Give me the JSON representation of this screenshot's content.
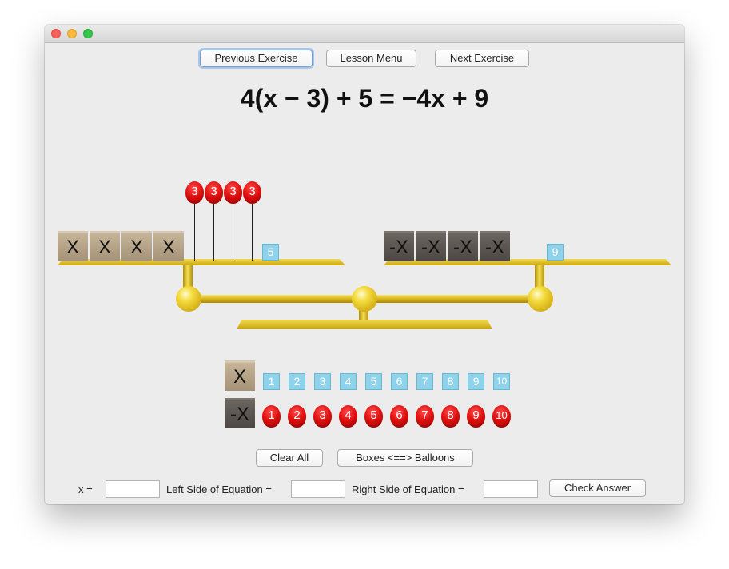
{
  "toolbar": {
    "prev_label": "Previous Exercise",
    "menu_label": "Lesson Menu",
    "next_label": "Next Exercise"
  },
  "equation": "4(x − 3) + 5 = −4x + 9",
  "scale": {
    "left": {
      "x_boxes": [
        "X",
        "X",
        "X",
        "X"
      ],
      "balloons": [
        "3",
        "3",
        "3",
        "3"
      ],
      "cubes": [
        "5"
      ]
    },
    "right": {
      "negx_boxes": [
        "-X",
        "-X",
        "-X",
        "-X"
      ],
      "cubes": [
        "9"
      ]
    }
  },
  "palette": {
    "x_box": "X",
    "negx_box": "-X",
    "cubes": [
      "1",
      "2",
      "3",
      "4",
      "5",
      "6",
      "7",
      "8",
      "9",
      "10"
    ],
    "balloons": [
      "1",
      "2",
      "3",
      "4",
      "5",
      "6",
      "7",
      "8",
      "9",
      "10"
    ]
  },
  "actions": {
    "clear_label": "Clear All",
    "swap_label": "Boxes <==> Balloons"
  },
  "answer": {
    "x_label": "x =",
    "left_label": "Left Side of Equation =",
    "right_label": "Right Side of Equation =",
    "x_value": "",
    "left_value": "",
    "right_value": "",
    "check_label": "Check Answer"
  },
  "colors": {
    "window_bg": "#ececec",
    "cube": "#8fd3ea",
    "balloon": "#e01010",
    "scale": "#e6c52a",
    "x_box": "#b6a386",
    "negx_box": "#5c5651"
  }
}
